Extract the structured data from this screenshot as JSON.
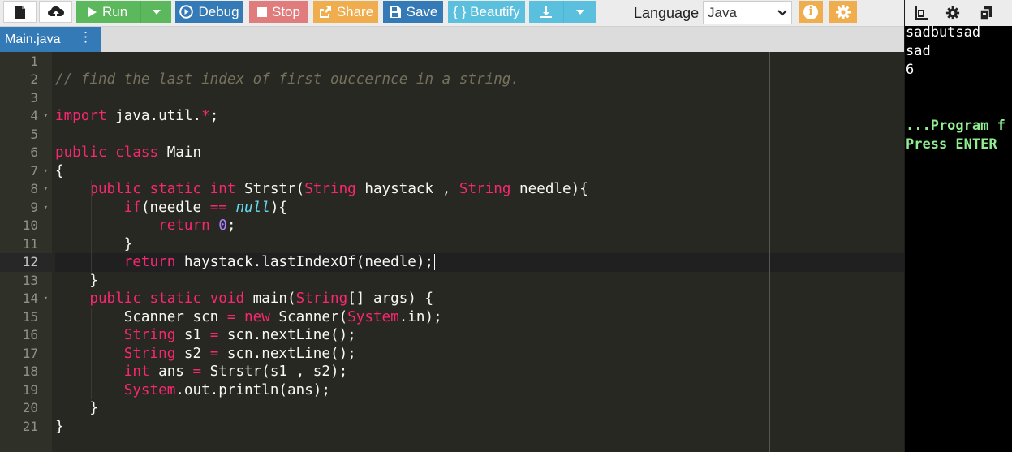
{
  "toolbar": {
    "run_label": "Run",
    "debug_label": "Debug",
    "stop_label": "Stop",
    "share_label": "Share",
    "save_label": "Save",
    "beautify_label": "{ } Beautify",
    "language_label": "Language",
    "language_value": "Java"
  },
  "tab": {
    "label": "Main.java"
  },
  "editor": {
    "active_line": 12,
    "lines": [
      {
        "n": "1",
        "tokens": []
      },
      {
        "n": "2",
        "tokens": [
          {
            "t": "cm",
            "v": "// find the last index of first ouccernce in a string."
          }
        ]
      },
      {
        "n": "3",
        "tokens": []
      },
      {
        "n": "4",
        "fold": true,
        "tokens": [
          {
            "t": "kw",
            "v": "import"
          },
          {
            "t": "plain",
            "v": " java.util."
          },
          {
            "t": "op",
            "v": "*"
          },
          {
            "t": "plain",
            "v": ";"
          }
        ]
      },
      {
        "n": "5",
        "tokens": []
      },
      {
        "n": "6",
        "tokens": [
          {
            "t": "kw",
            "v": "public"
          },
          {
            "t": "plain",
            "v": " "
          },
          {
            "t": "kw",
            "v": "class"
          },
          {
            "t": "plain",
            "v": " Main"
          }
        ]
      },
      {
        "n": "7",
        "fold": true,
        "tokens": [
          {
            "t": "plain",
            "v": "{"
          }
        ]
      },
      {
        "n": "8",
        "fold": true,
        "tokens": [
          {
            "t": "plain",
            "v": "    "
          },
          {
            "t": "kw",
            "v": "public"
          },
          {
            "t": "plain",
            "v": " "
          },
          {
            "t": "kw",
            "v": "static"
          },
          {
            "t": "plain",
            "v": " "
          },
          {
            "t": "kw",
            "v": "int"
          },
          {
            "t": "plain",
            "v": " Strstr("
          },
          {
            "t": "kw",
            "v": "String"
          },
          {
            "t": "plain",
            "v": " haystack , "
          },
          {
            "t": "kw",
            "v": "String"
          },
          {
            "t": "plain",
            "v": " needle){"
          }
        ]
      },
      {
        "n": "9",
        "fold": true,
        "tokens": [
          {
            "t": "plain",
            "v": "        "
          },
          {
            "t": "kw",
            "v": "if"
          },
          {
            "t": "plain",
            "v": "(needle "
          },
          {
            "t": "op",
            "v": "=="
          },
          {
            "t": "plain",
            "v": " "
          },
          {
            "t": "sty",
            "v": "null"
          },
          {
            "t": "plain",
            "v": "){"
          }
        ]
      },
      {
        "n": "10",
        "tokens": [
          {
            "t": "plain",
            "v": "            "
          },
          {
            "t": "kw",
            "v": "return"
          },
          {
            "t": "plain",
            "v": " "
          },
          {
            "t": "num",
            "v": "0"
          },
          {
            "t": "plain",
            "v": ";"
          }
        ]
      },
      {
        "n": "11",
        "tokens": [
          {
            "t": "plain",
            "v": "        }"
          }
        ]
      },
      {
        "n": "12",
        "tokens": [
          {
            "t": "plain",
            "v": "        "
          },
          {
            "t": "kw",
            "v": "return"
          },
          {
            "t": "plain",
            "v": " haystack.lastIndexOf(needle);"
          }
        ]
      },
      {
        "n": "13",
        "tokens": [
          {
            "t": "plain",
            "v": "    }"
          }
        ]
      },
      {
        "n": "14",
        "fold": true,
        "tokens": [
          {
            "t": "plain",
            "v": "    "
          },
          {
            "t": "kw",
            "v": "public"
          },
          {
            "t": "plain",
            "v": " "
          },
          {
            "t": "kw",
            "v": "static"
          },
          {
            "t": "plain",
            "v": " "
          },
          {
            "t": "kw",
            "v": "void"
          },
          {
            "t": "plain",
            "v": " main("
          },
          {
            "t": "kw",
            "v": "String"
          },
          {
            "t": "plain",
            "v": "[] args) {"
          }
        ]
      },
      {
        "n": "15",
        "tokens": [
          {
            "t": "plain",
            "v": "        Scanner scn "
          },
          {
            "t": "op",
            "v": "="
          },
          {
            "t": "plain",
            "v": " "
          },
          {
            "t": "kw",
            "v": "new"
          },
          {
            "t": "plain",
            "v": " Scanner("
          },
          {
            "t": "kw",
            "v": "System"
          },
          {
            "t": "plain",
            "v": ".in);"
          }
        ]
      },
      {
        "n": "16",
        "tokens": [
          {
            "t": "plain",
            "v": "        "
          },
          {
            "t": "kw",
            "v": "String"
          },
          {
            "t": "plain",
            "v": " s1 "
          },
          {
            "t": "op",
            "v": "="
          },
          {
            "t": "plain",
            "v": " scn.nextLine();"
          }
        ]
      },
      {
        "n": "17",
        "tokens": [
          {
            "t": "plain",
            "v": "        "
          },
          {
            "t": "kw",
            "v": "String"
          },
          {
            "t": "plain",
            "v": " s2 "
          },
          {
            "t": "op",
            "v": "="
          },
          {
            "t": "plain",
            "v": " scn.nextLine();"
          }
        ]
      },
      {
        "n": "18",
        "tokens": [
          {
            "t": "plain",
            "v": "        "
          },
          {
            "t": "kw",
            "v": "int"
          },
          {
            "t": "plain",
            "v": " ans "
          },
          {
            "t": "op",
            "v": "="
          },
          {
            "t": "plain",
            "v": " Strstr(s1 , s2);"
          }
        ]
      },
      {
        "n": "19",
        "tokens": [
          {
            "t": "plain",
            "v": "        "
          },
          {
            "t": "kw",
            "v": "System"
          },
          {
            "t": "plain",
            "v": ".out.println(ans);"
          }
        ]
      },
      {
        "n": "20",
        "tokens": [
          {
            "t": "plain",
            "v": "    }"
          }
        ]
      },
      {
        "n": "21",
        "tokens": [
          {
            "t": "plain",
            "v": "}"
          }
        ]
      }
    ]
  },
  "output": {
    "lines": [
      {
        "text": "sadbutsad",
        "style": "normal"
      },
      {
        "text": "sad",
        "style": "normal"
      },
      {
        "text": "6",
        "style": "normal"
      },
      {
        "text": "",
        "style": "normal"
      },
      {
        "text": "",
        "style": "normal"
      },
      {
        "text": "...Program f",
        "style": "green"
      },
      {
        "text": "Press ENTER",
        "style": "green"
      }
    ]
  },
  "colors": {
    "run": "#5cb85c",
    "debug": "#337ab7",
    "stop": "#e07c7c",
    "share": "#f0ad4e",
    "beautify": "#5bc0de",
    "editor_bg": "#272822",
    "keyword": "#f92672",
    "comment": "#75715e",
    "number": "#ae81ff",
    "builtin": "#66d9ef"
  }
}
